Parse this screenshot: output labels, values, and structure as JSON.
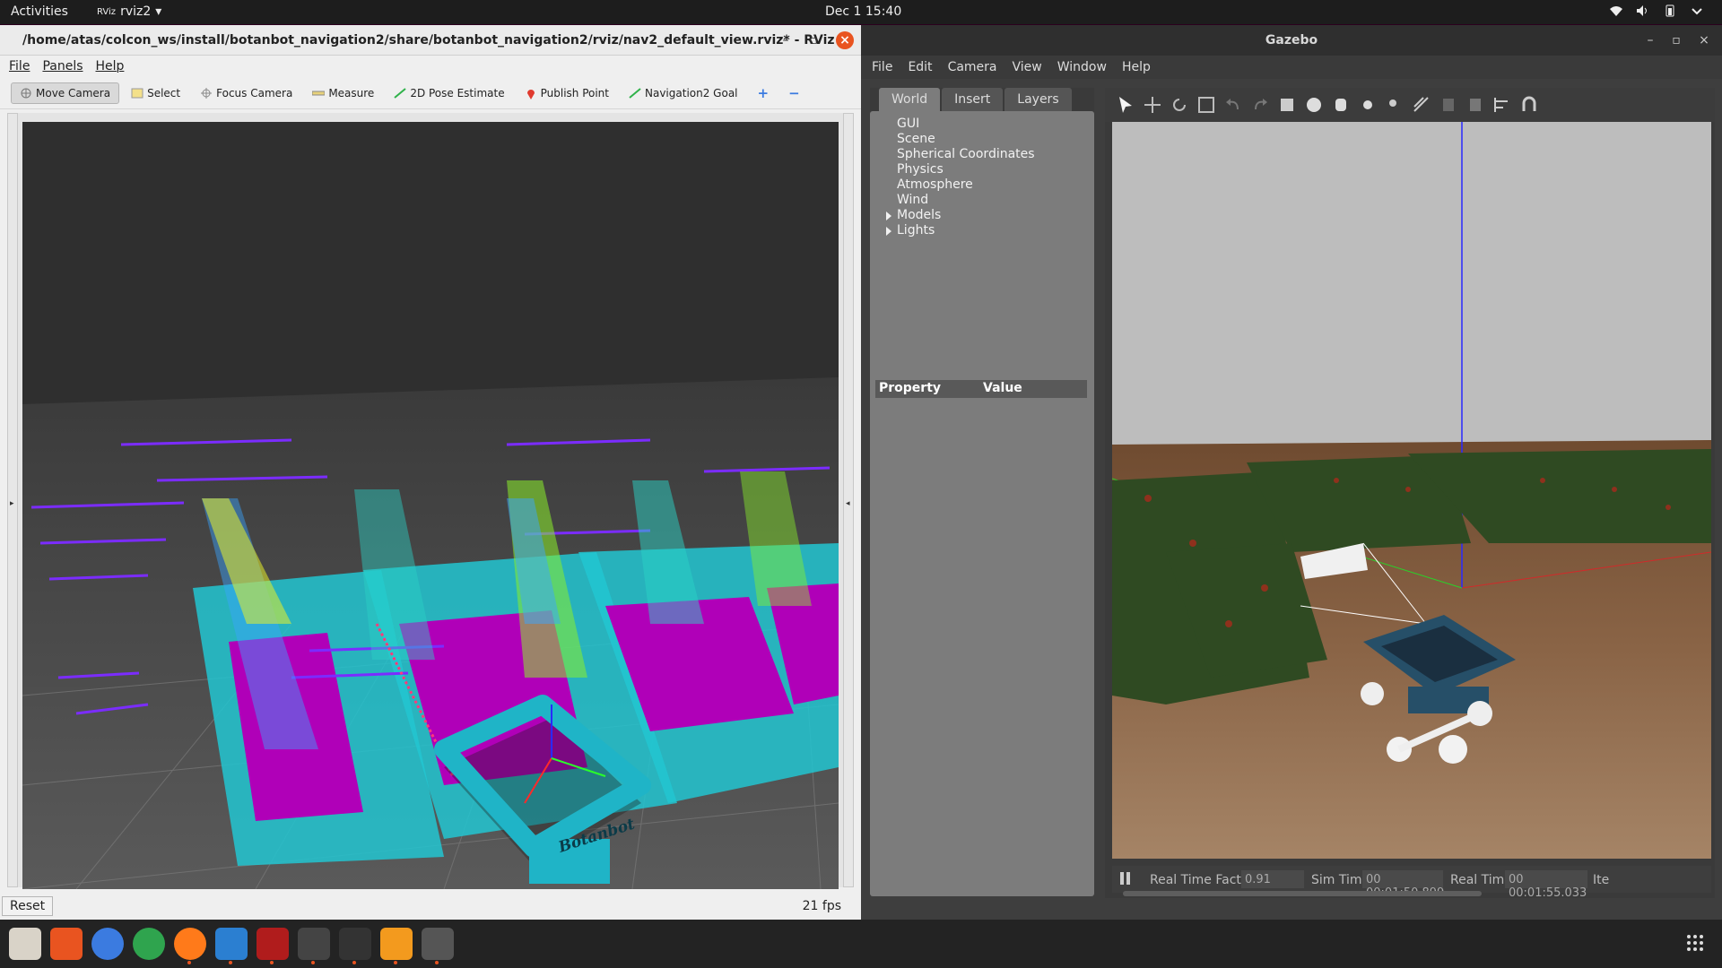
{
  "topbar": {
    "activities": "Activities",
    "app_name": "rviz2",
    "clock": "Dec 1  15:40"
  },
  "rviz": {
    "title": "/home/atas/colcon_ws/install/botanbot_navigation2/share/botanbot_navigation2/rviz/nav2_default_view.rviz* - RViz",
    "menu": [
      "File",
      "Panels",
      "Help"
    ],
    "tools": [
      {
        "label": "Move Camera",
        "icon": "move-camera-icon",
        "active": true
      },
      {
        "label": "Select",
        "icon": "select-icon"
      },
      {
        "label": "Focus Camera",
        "icon": "focus-camera-icon"
      },
      {
        "label": "Measure",
        "icon": "measure-icon"
      },
      {
        "label": "2D Pose Estimate",
        "icon": "pose-estimate-icon"
      },
      {
        "label": "Publish Point",
        "icon": "publish-point-icon"
      },
      {
        "label": "Navigation2 Goal",
        "icon": "nav-goal-icon"
      }
    ],
    "robot_label": "Botanbot",
    "reset_label": "Reset",
    "fps": "21 fps"
  },
  "gazebo": {
    "title": "Gazebo",
    "menu": [
      "File",
      "Edit",
      "Camera",
      "View",
      "Window",
      "Help"
    ],
    "tabs": [
      "World",
      "Insert",
      "Layers"
    ],
    "tree": [
      "GUI",
      "Scene",
      "Spherical Coordinates",
      "Physics",
      "Atmosphere",
      "Wind",
      "Models",
      "Lights"
    ],
    "prop_header": {
      "property": "Property",
      "value": "Value"
    },
    "status": {
      "rtf_label": "Real Time Factor:",
      "rtf_value": "0.91",
      "sim_label": "Sim Time:",
      "sim_value": "00 00:01:50.899",
      "real_label": "Real Time:",
      "real_value": "00 00:01:55.033",
      "iter_label": "Ite"
    }
  },
  "colors": {
    "ubuntu_orange": "#e95420",
    "costmap_cyan": "#22c5d1",
    "costmap_magenta": "#b000b8",
    "robot_teal": "#1fb4c7",
    "gazebo_robot": "#264f68"
  }
}
